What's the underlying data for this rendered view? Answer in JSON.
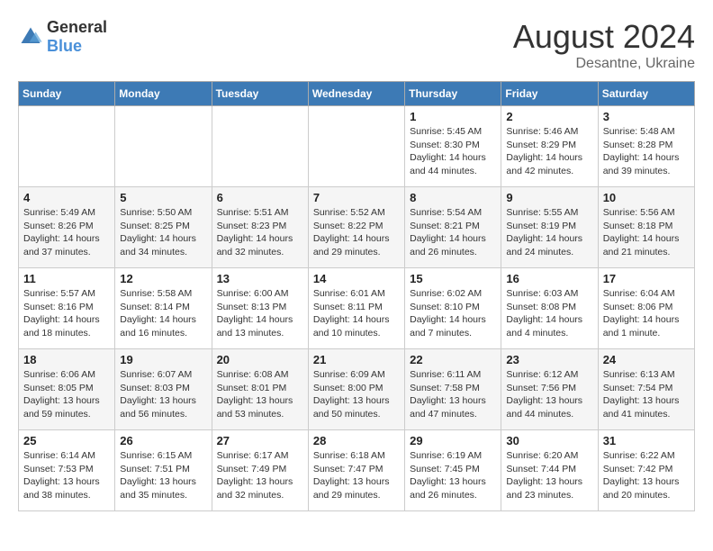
{
  "logo": {
    "general": "General",
    "blue": "Blue"
  },
  "title": {
    "month_year": "August 2024",
    "location": "Desantne, Ukraine"
  },
  "weekdays": [
    "Sunday",
    "Monday",
    "Tuesday",
    "Wednesday",
    "Thursday",
    "Friday",
    "Saturday"
  ],
  "weeks": [
    [
      {
        "day": "",
        "info": ""
      },
      {
        "day": "",
        "info": ""
      },
      {
        "day": "",
        "info": ""
      },
      {
        "day": "",
        "info": ""
      },
      {
        "day": "1",
        "info": "Sunrise: 5:45 AM\nSunset: 8:30 PM\nDaylight: 14 hours\nand 44 minutes."
      },
      {
        "day": "2",
        "info": "Sunrise: 5:46 AM\nSunset: 8:29 PM\nDaylight: 14 hours\nand 42 minutes."
      },
      {
        "day": "3",
        "info": "Sunrise: 5:48 AM\nSunset: 8:28 PM\nDaylight: 14 hours\nand 39 minutes."
      }
    ],
    [
      {
        "day": "4",
        "info": "Sunrise: 5:49 AM\nSunset: 8:26 PM\nDaylight: 14 hours\nand 37 minutes."
      },
      {
        "day": "5",
        "info": "Sunrise: 5:50 AM\nSunset: 8:25 PM\nDaylight: 14 hours\nand 34 minutes."
      },
      {
        "day": "6",
        "info": "Sunrise: 5:51 AM\nSunset: 8:23 PM\nDaylight: 14 hours\nand 32 minutes."
      },
      {
        "day": "7",
        "info": "Sunrise: 5:52 AM\nSunset: 8:22 PM\nDaylight: 14 hours\nand 29 minutes."
      },
      {
        "day": "8",
        "info": "Sunrise: 5:54 AM\nSunset: 8:21 PM\nDaylight: 14 hours\nand 26 minutes."
      },
      {
        "day": "9",
        "info": "Sunrise: 5:55 AM\nSunset: 8:19 PM\nDaylight: 14 hours\nand 24 minutes."
      },
      {
        "day": "10",
        "info": "Sunrise: 5:56 AM\nSunset: 8:18 PM\nDaylight: 14 hours\nand 21 minutes."
      }
    ],
    [
      {
        "day": "11",
        "info": "Sunrise: 5:57 AM\nSunset: 8:16 PM\nDaylight: 14 hours\nand 18 minutes."
      },
      {
        "day": "12",
        "info": "Sunrise: 5:58 AM\nSunset: 8:14 PM\nDaylight: 14 hours\nand 16 minutes."
      },
      {
        "day": "13",
        "info": "Sunrise: 6:00 AM\nSunset: 8:13 PM\nDaylight: 14 hours\nand 13 minutes."
      },
      {
        "day": "14",
        "info": "Sunrise: 6:01 AM\nSunset: 8:11 PM\nDaylight: 14 hours\nand 10 minutes."
      },
      {
        "day": "15",
        "info": "Sunrise: 6:02 AM\nSunset: 8:10 PM\nDaylight: 14 hours\nand 7 minutes."
      },
      {
        "day": "16",
        "info": "Sunrise: 6:03 AM\nSunset: 8:08 PM\nDaylight: 14 hours\nand 4 minutes."
      },
      {
        "day": "17",
        "info": "Sunrise: 6:04 AM\nSunset: 8:06 PM\nDaylight: 14 hours\nand 1 minute."
      }
    ],
    [
      {
        "day": "18",
        "info": "Sunrise: 6:06 AM\nSunset: 8:05 PM\nDaylight: 13 hours\nand 59 minutes."
      },
      {
        "day": "19",
        "info": "Sunrise: 6:07 AM\nSunset: 8:03 PM\nDaylight: 13 hours\nand 56 minutes."
      },
      {
        "day": "20",
        "info": "Sunrise: 6:08 AM\nSunset: 8:01 PM\nDaylight: 13 hours\nand 53 minutes."
      },
      {
        "day": "21",
        "info": "Sunrise: 6:09 AM\nSunset: 8:00 PM\nDaylight: 13 hours\nand 50 minutes."
      },
      {
        "day": "22",
        "info": "Sunrise: 6:11 AM\nSunset: 7:58 PM\nDaylight: 13 hours\nand 47 minutes."
      },
      {
        "day": "23",
        "info": "Sunrise: 6:12 AM\nSunset: 7:56 PM\nDaylight: 13 hours\nand 44 minutes."
      },
      {
        "day": "24",
        "info": "Sunrise: 6:13 AM\nSunset: 7:54 PM\nDaylight: 13 hours\nand 41 minutes."
      }
    ],
    [
      {
        "day": "25",
        "info": "Sunrise: 6:14 AM\nSunset: 7:53 PM\nDaylight: 13 hours\nand 38 minutes."
      },
      {
        "day": "26",
        "info": "Sunrise: 6:15 AM\nSunset: 7:51 PM\nDaylight: 13 hours\nand 35 minutes."
      },
      {
        "day": "27",
        "info": "Sunrise: 6:17 AM\nSunset: 7:49 PM\nDaylight: 13 hours\nand 32 minutes."
      },
      {
        "day": "28",
        "info": "Sunrise: 6:18 AM\nSunset: 7:47 PM\nDaylight: 13 hours\nand 29 minutes."
      },
      {
        "day": "29",
        "info": "Sunrise: 6:19 AM\nSunset: 7:45 PM\nDaylight: 13 hours\nand 26 minutes."
      },
      {
        "day": "30",
        "info": "Sunrise: 6:20 AM\nSunset: 7:44 PM\nDaylight: 13 hours\nand 23 minutes."
      },
      {
        "day": "31",
        "info": "Sunrise: 6:22 AM\nSunset: 7:42 PM\nDaylight: 13 hours\nand 20 minutes."
      }
    ]
  ]
}
